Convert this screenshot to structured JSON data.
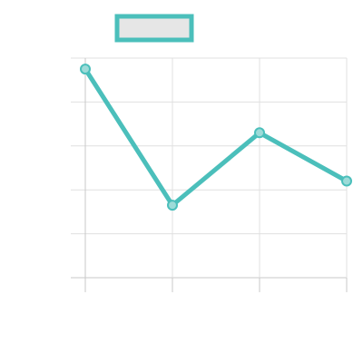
{
  "colors": {
    "series": "#4bbfbb",
    "point_fill": "#9ddbd8",
    "legend_fill": "#e6e6e6",
    "grid": "#e0e0e0",
    "axis": "#c8c8c8"
  },
  "chart_data": {
    "type": "line",
    "title": "",
    "xlabel": "",
    "ylabel": "",
    "x": [
      0,
      1,
      2,
      3
    ],
    "series": [
      {
        "values": [
          9.5,
          3.3,
          6.6,
          4.4
        ]
      }
    ],
    "xlim": [
      0,
      3
    ],
    "ylim": [
      0,
      10
    ],
    "yticks": [
      0,
      2,
      4,
      6,
      8,
      10
    ],
    "grid": true,
    "legend": {
      "placement": "top-left",
      "entries": [
        ""
      ]
    },
    "show_tick_labels": false
  }
}
